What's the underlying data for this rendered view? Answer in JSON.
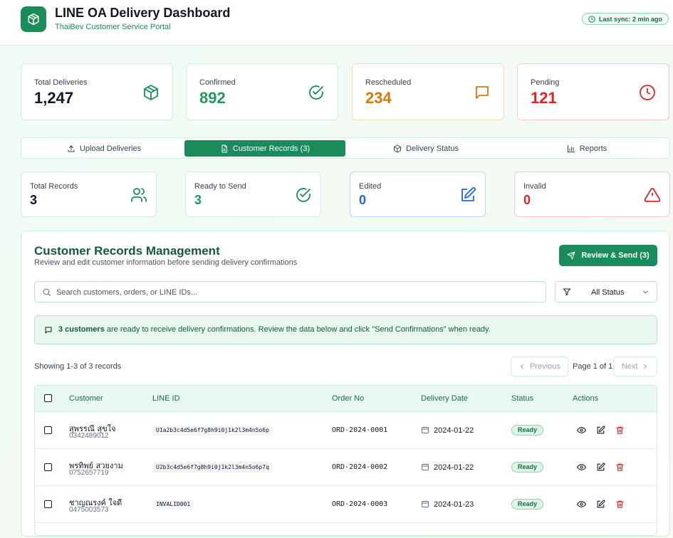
{
  "header": {
    "title": "LINE OA Delivery Dashboard",
    "subtitle": "ThaiBev Customer Service Portal",
    "sync": "Last sync: 2 min ago"
  },
  "stats": [
    {
      "label": "Total Deliveries",
      "value": "1,247",
      "icon": "box-icon",
      "color": "#111827",
      "border": "#cdeedd"
    },
    {
      "label": "Confirmed",
      "value": "892",
      "icon": "check-circle-icon",
      "color": "#1f9a5e",
      "border": "#cdeedd"
    },
    {
      "label": "Rescheduled",
      "value": "234",
      "icon": "message-icon",
      "color": "#d9770b",
      "border": "#f6dca0"
    },
    {
      "label": "Pending",
      "value": "121",
      "icon": "clock-icon",
      "color": "#dc2626",
      "border": "#f5c9c9"
    }
  ],
  "tabs": [
    {
      "label": "Upload Deliveries",
      "icon": "upload-icon",
      "active": false
    },
    {
      "label": "Customer Records (3)",
      "icon": "document-icon",
      "active": true
    },
    {
      "label": "Delivery Status",
      "icon": "box-icon",
      "active": false
    },
    {
      "label": "Reports",
      "icon": "bar-chart-icon",
      "active": false
    }
  ],
  "record_stats": [
    {
      "label": "Total Records",
      "value": "3",
      "icon": "users-icon",
      "color": "#111827"
    },
    {
      "label": "Ready to Send",
      "value": "3",
      "icon": "check-circle-icon",
      "color": "#1f9a5e"
    },
    {
      "label": "Edited",
      "value": "0",
      "icon": "edit-icon",
      "color": "#2563eb"
    },
    {
      "label": "Invalid",
      "value": "0",
      "icon": "warning-icon",
      "color": "#dc2626"
    }
  ],
  "panel": {
    "title": "Customer Records Management",
    "subtitle": "Review and edit customer information before sending delivery confirmations",
    "send_label": "Review & Send (3)",
    "search_placeholder": "Search customers, orders, or LINE IDs...",
    "filter_value": "All Status",
    "notice_bold": "3 customers",
    "notice_rest": " are ready to receive delivery confirmations. Review the data below and click \"Send Confirmations\" when ready.",
    "showing": "Showing 1-3 of 3 records",
    "prev_label": "Previous",
    "page_info": "Page 1 of 1",
    "next_label": "Next"
  },
  "table": {
    "headers": [
      "Customer",
      "LINE ID",
      "Order No",
      "Delivery Date",
      "Status",
      "Actions"
    ],
    "rows": [
      {
        "name": "สุพรรณี สุขใจ",
        "phone": "0342489012",
        "line_id": "U1a2b3c4d5e6f7g8h9i0j1k2l3m4n5o6p",
        "order": "ORD-2024-0001",
        "date": "2024-01-22",
        "status": "Ready"
      },
      {
        "name": "พรทิพย์ สวยงาม",
        "phone": "0752657719",
        "line_id": "U2b3c4d5e6f7g8h9i0j1k2l3m4n5o6p7q",
        "order": "ORD-2024-0002",
        "date": "2024-01-22",
        "status": "Ready"
      },
      {
        "name": "ชาญณรงค์ ใจดี",
        "phone": "0475003573",
        "line_id": "INVALID001",
        "order": "ORD-2024-0003",
        "date": "2024-01-23",
        "status": "Ready"
      }
    ]
  }
}
